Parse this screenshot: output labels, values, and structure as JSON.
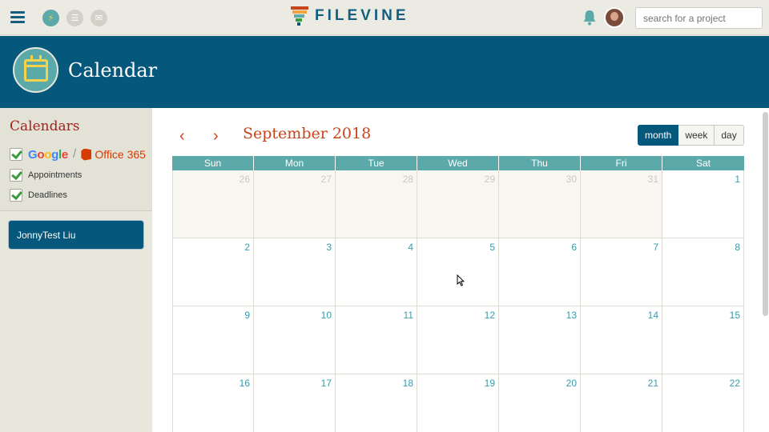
{
  "topbar": {
    "logo_text": "FILEVINE",
    "search_placeholder": "search for a project",
    "icons": [
      "menu-icon",
      "bolt-icon",
      "list-icon",
      "mail-icon",
      "bell-icon",
      "avatar"
    ]
  },
  "header": {
    "title": "Calendar",
    "icon": "calendar-icon"
  },
  "sidebar": {
    "title": "Calendars",
    "items": [
      {
        "google": "Google",
        "office": "Office 365"
      },
      {
        "label": "Appointments"
      },
      {
        "label": "Deadlines"
      }
    ],
    "user_name": "JonnyTest Liu"
  },
  "calendar": {
    "prev": "‹",
    "next": "›",
    "month_title": "September 2018",
    "views": [
      "month",
      "week",
      "day"
    ],
    "active_view": "month",
    "weekdays": [
      "Sun",
      "Mon",
      "Tue",
      "Wed",
      "Thu",
      "Fri",
      "Sat"
    ],
    "weeks": [
      [
        "26",
        "27",
        "28",
        "29",
        "30",
        "31",
        "1"
      ],
      [
        "2",
        "3",
        "4",
        "5",
        "6",
        "7",
        "8"
      ],
      [
        "9",
        "10",
        "11",
        "12",
        "13",
        "14",
        "15"
      ],
      [
        "16",
        "17",
        "18",
        "19",
        "20",
        "21",
        "22"
      ]
    ]
  },
  "colors": {
    "primary": "#05587c",
    "teal": "#5ba9a8",
    "accent": "#c8451c",
    "calendars_title": "#a1241d"
  }
}
